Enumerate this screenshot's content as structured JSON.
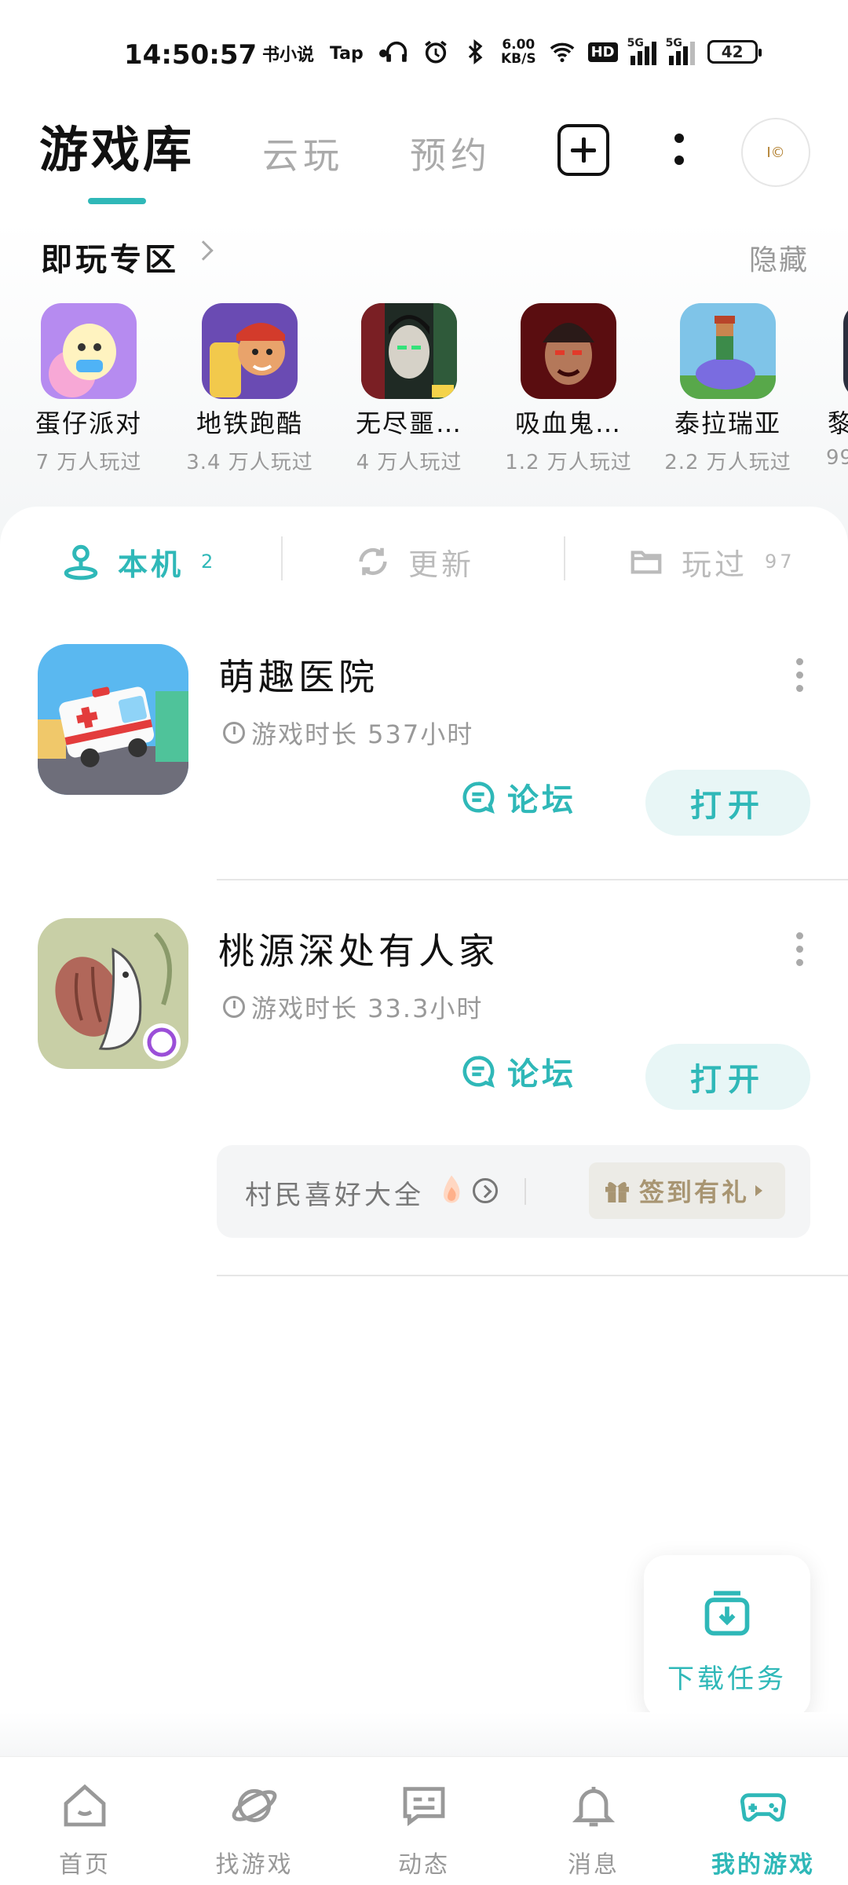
{
  "status_bar": {
    "time": "14:50:57",
    "left_icons": [
      "书小说",
      "Tap"
    ],
    "net_speed_value": "6.00",
    "net_speed_unit": "KB/S",
    "hd_label": "HD",
    "sim1_label": "5G",
    "sim2_label": "5G",
    "battery": "42"
  },
  "header": {
    "tab_library": "游戏库",
    "tab_cloud": "云玩",
    "tab_reserve": "预约",
    "avatar_text": "I©"
  },
  "instant_play": {
    "title": "即玩专区",
    "hide_label": "隐藏",
    "items": [
      {
        "name": "蛋仔派对",
        "count": "7 万人玩过"
      },
      {
        "name": "地铁跑酷",
        "count": "3.4 万人玩过"
      },
      {
        "name": "无尽噩…",
        "count": "4 万人玩过"
      },
      {
        "name": "吸血鬼…",
        "count": "1.2 万人玩过"
      },
      {
        "name": "泰拉瑞亚",
        "count": "2.2 万人玩过"
      },
      {
        "name": "黎",
        "count": "99."
      }
    ]
  },
  "segments": {
    "local_label": "本机",
    "local_count": "2",
    "update_label": "更新",
    "played_label": "玩过",
    "played_count": "97"
  },
  "games": [
    {
      "name": "萌趣医院",
      "playtime": "游戏时长 537小时",
      "forum_label": "论坛",
      "open_label": "打开"
    },
    {
      "name": "桃源深处有人家",
      "playtime": "游戏时长 33.3小时",
      "forum_label": "论坛",
      "open_label": "打开"
    }
  ],
  "promo": {
    "text": "村民喜好大全",
    "gift_label": "签到有礼"
  },
  "fab": {
    "label": "下载任务"
  },
  "bottom_nav": [
    {
      "label": "首页",
      "icon": "home-icon"
    },
    {
      "label": "找游戏",
      "icon": "planet-icon"
    },
    {
      "label": "动态",
      "icon": "chat-card-icon"
    },
    {
      "label": "消息",
      "icon": "bell-icon"
    },
    {
      "label": "我的游戏",
      "icon": "gamepad-icon"
    }
  ],
  "colors": {
    "accent": "#2fb8b8",
    "muted": "#999999",
    "gift": "#a89572"
  }
}
